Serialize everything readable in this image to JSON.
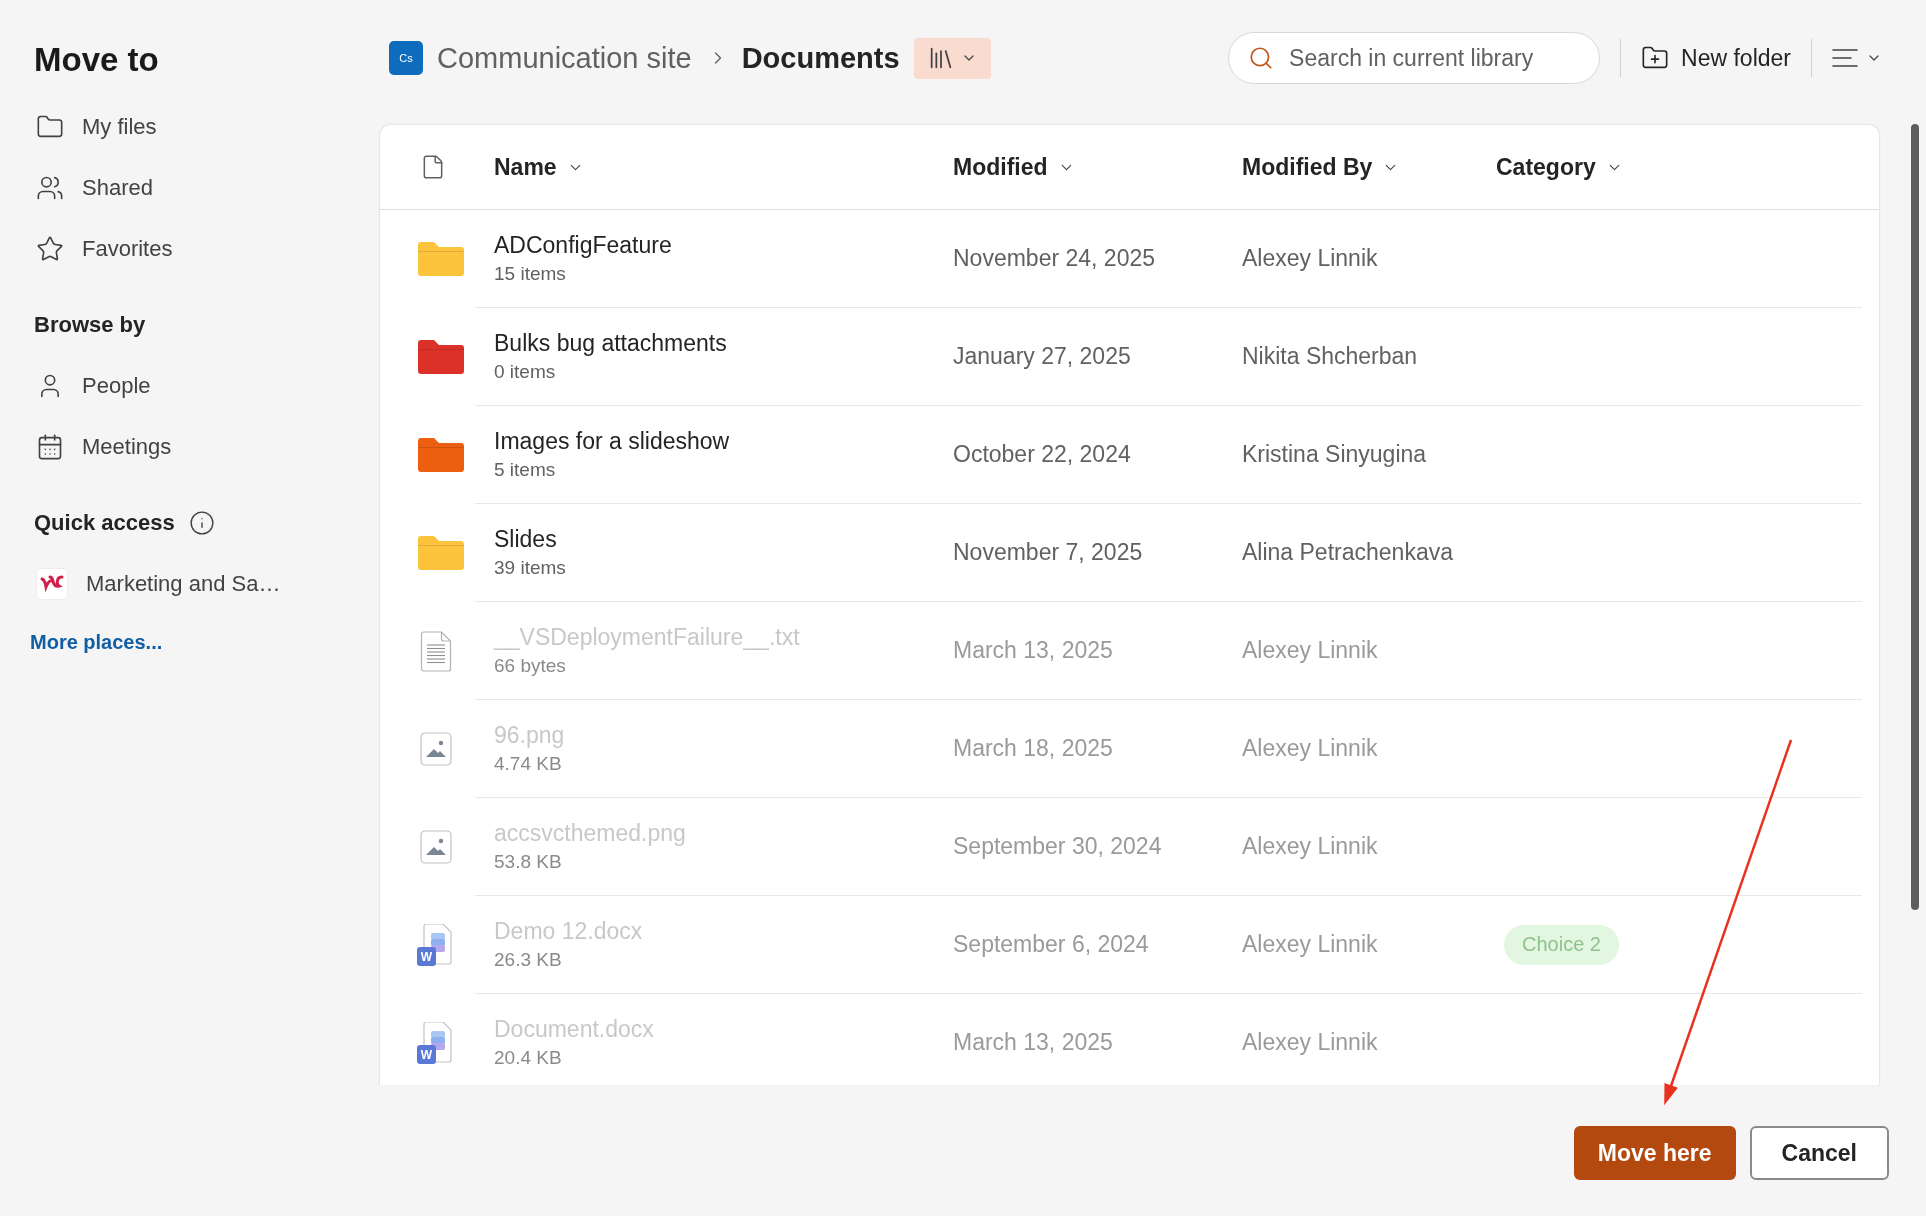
{
  "sidebar": {
    "title": "Move to",
    "groups": [
      {
        "items": [
          {
            "kind": "folder",
            "label": "My files",
            "selected": false
          },
          {
            "kind": "people",
            "label": "Shared",
            "selected": false
          },
          {
            "kind": "star",
            "label": "Favorites",
            "selected": false
          }
        ]
      },
      {
        "heading": "Browse by",
        "items": [
          {
            "kind": "person",
            "label": "People",
            "selected": false
          },
          {
            "kind": "calendar",
            "label": "Meetings",
            "selected": false
          }
        ]
      },
      {
        "heading": "Quick access",
        "info": true,
        "items": [
          {
            "kind": "site",
            "label": "Marketing and Sa…",
            "selected": false
          }
        ]
      }
    ],
    "more_link": "More places..."
  },
  "breadcrumb": {
    "site_badge": "Cs",
    "items": [
      {
        "label": "Communication site",
        "current": false
      },
      {
        "label": "Documents",
        "current": true
      }
    ]
  },
  "toolbar": {
    "search": {
      "placeholder": "Search in current library"
    },
    "new_folder": "New folder"
  },
  "table": {
    "columns": [
      {
        "label": "Name"
      },
      {
        "label": "Modified"
      },
      {
        "label": "Modified By"
      },
      {
        "label": "Category"
      }
    ],
    "rows": [
      {
        "kind": "folder",
        "color": "#fcc43d",
        "name": "ADConfigFeature",
        "detail": "15 items",
        "modified": "November 24, 2025",
        "modified_by": "Alexey Linnik",
        "disabled": false
      },
      {
        "kind": "folder",
        "color": "#dc3129",
        "name": "Bulks bug attachments",
        "detail": "0 items",
        "modified": "January 27, 2025",
        "modified_by": "Nikita Shcherban",
        "disabled": false
      },
      {
        "kind": "folder",
        "color": "#ec5f10",
        "name": "Images for a slideshow",
        "detail": "5 items",
        "modified": "October 22, 2024",
        "modified_by": "Kristina Sinyugina",
        "disabled": false
      },
      {
        "kind": "folder",
        "color": "#fcc43d",
        "name": "Slides",
        "detail": "39 items",
        "modified": "November 7, 2025",
        "modified_by": "Alina Petrachenkava",
        "disabled": false
      },
      {
        "kind": "text",
        "name": "__VSDeploymentFailure__.txt",
        "detail": "66 bytes",
        "modified": "March 13, 2025",
        "modified_by": "Alexey Linnik",
        "disabled": true
      },
      {
        "kind": "image",
        "name": "96.png",
        "detail": "4.74 KB",
        "modified": "March 18, 2025",
        "modified_by": "Alexey Linnik",
        "disabled": true
      },
      {
        "kind": "image",
        "name": "accsvcthemed.png",
        "detail": "53.8 KB",
        "modified": "September 30, 2024",
        "modified_by": "Alexey Linnik",
        "disabled": true
      },
      {
        "kind": "word",
        "badge": "W",
        "name": "Demo 12.docx",
        "detail": "26.3 KB",
        "modified": "September 6, 2024",
        "modified_by": "Alexey Linnik",
        "category": "Choice 2",
        "disabled": true
      },
      {
        "kind": "word",
        "badge": "W",
        "name": "Document.docx",
        "detail": "20.4 KB",
        "modified": "March 13, 2025",
        "modified_by": "Alexey Linnik",
        "disabled": true
      }
    ]
  },
  "buttons": [
    {
      "label": "Move here",
      "kind": "primary"
    },
    {
      "label": "Cancel",
      "kind": "secondary"
    }
  ]
}
